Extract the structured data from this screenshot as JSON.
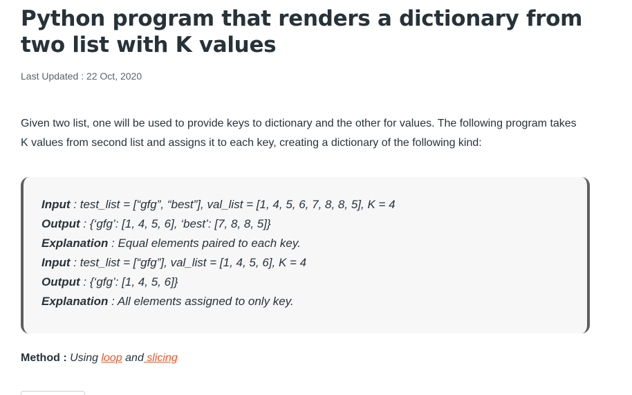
{
  "article": {
    "title": "Python program that renders a dictionary from two list with K values",
    "last_updated": "Last Updated : 22 Oct, 2020",
    "intro": "Given two list, one will be used to provide keys to dictionary and the other for values. The following program takes K values from second list and assigns it to each key, creating a dictionary of the following kind:"
  },
  "examples": [
    {
      "label": "Input",
      "text": " : test_list = [“gfg”, “best”], val_list = [1, 4, 5, 6, 7, 8, 8, 5], K = 4"
    },
    {
      "label": "Output",
      "text": " : {‘gfg’: [1, 4, 5, 6], ‘best’: [7, 8, 8, 5]}"
    },
    {
      "label": "Explanation",
      "text": " : Equal elements paired to each key."
    },
    {
      "label": "Input",
      "text": " : test_list = [“gfg”], val_list = [1, 4, 5, 6], K = 4"
    },
    {
      "label": "Output",
      "text": " : {‘gfg’: [1, 4, 5, 6]}"
    },
    {
      "label": "Explanation",
      "text": " : All elements assigned to only key."
    }
  ],
  "method": {
    "label": "Method : ",
    "prefix": "Using ",
    "link1": "loop",
    "middle": " and",
    "link2": " slicing"
  },
  "colors": {
    "text": "#273239",
    "link": "#e2592a",
    "box_bg": "#f7f7f7",
    "box_border": "#5f5f5f"
  }
}
